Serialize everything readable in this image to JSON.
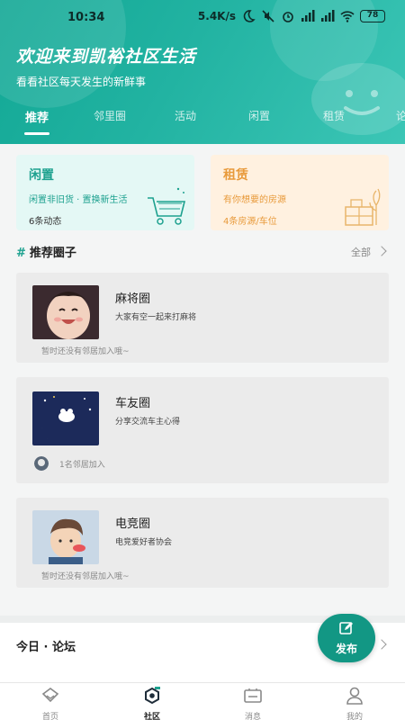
{
  "status_bar": {
    "time": "10:34",
    "speed": "5.4K/s",
    "battery": "78"
  },
  "header": {
    "title": "欢迎来到凯裕社区生活",
    "subtitle": "看看社区每天发生的新鲜事"
  },
  "tabs": [
    {
      "label": "推荐"
    },
    {
      "label": "邻里圈"
    },
    {
      "label": "活动"
    },
    {
      "label": "闲置"
    },
    {
      "label": "租赁"
    },
    {
      "label": "论"
    }
  ],
  "cards": {
    "idle": {
      "title": "闲置",
      "desc": "闲置非旧货 · 置换新生活",
      "count": "6条动态"
    },
    "rent": {
      "title": "租赁",
      "desc": "有你想要的房源",
      "count": "4条房源/车位"
    }
  },
  "recommend": {
    "hash": "#",
    "title": "推荐圈子",
    "all": "全部"
  },
  "circles": [
    {
      "name": "麻将圈",
      "desc": "大家有空一起来打麻将",
      "meta": "暂时还没有邻居加入哦~"
    },
    {
      "name": "车友圈",
      "desc": "分享交流车主心得",
      "meta": "1名邻居加入"
    },
    {
      "name": "电竞圈",
      "desc": "电竞爱好者协会",
      "meta": "暂时还没有邻居加入哦~"
    }
  ],
  "forum": {
    "title": "今日 · 论坛"
  },
  "fab": {
    "label": "发布"
  },
  "nav": [
    {
      "label": "首页",
      "icon": "home-icon"
    },
    {
      "label": "社区",
      "icon": "community-icon"
    },
    {
      "label": "消息",
      "icon": "message-icon"
    },
    {
      "label": "我的",
      "icon": "profile-icon"
    }
  ],
  "colors": {
    "accent": "#1da18f",
    "rent": "#e89a3b"
  }
}
